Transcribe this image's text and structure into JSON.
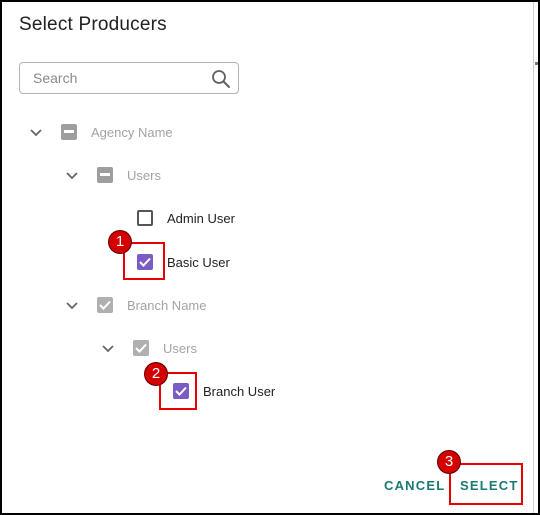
{
  "dialog": {
    "title": "Select Producers"
  },
  "search": {
    "placeholder": "Search",
    "value": ""
  },
  "tree": {
    "agency": {
      "label": "Agency Name",
      "state": "indeterminate"
    },
    "agency_users": {
      "label": "Users",
      "state": "indeterminate"
    },
    "admin_user": {
      "label": "Admin User",
      "checked": false
    },
    "basic_user": {
      "label": "Basic User",
      "checked": true
    },
    "branch": {
      "label": "Branch Name",
      "state": "checked"
    },
    "branch_users": {
      "label": "Users",
      "state": "checked"
    },
    "branch_user": {
      "label": "Branch User",
      "checked": true
    }
  },
  "annotations": {
    "badge1": "1",
    "badge2": "2",
    "badge3": "3"
  },
  "actions": {
    "cancel_label": "CANCEL",
    "select_label": "SELECT"
  },
  "colors": {
    "accent": "#7b5cc4",
    "button_text": "#1a7a72",
    "highlight": "#e60000",
    "badge": "#d40000"
  }
}
